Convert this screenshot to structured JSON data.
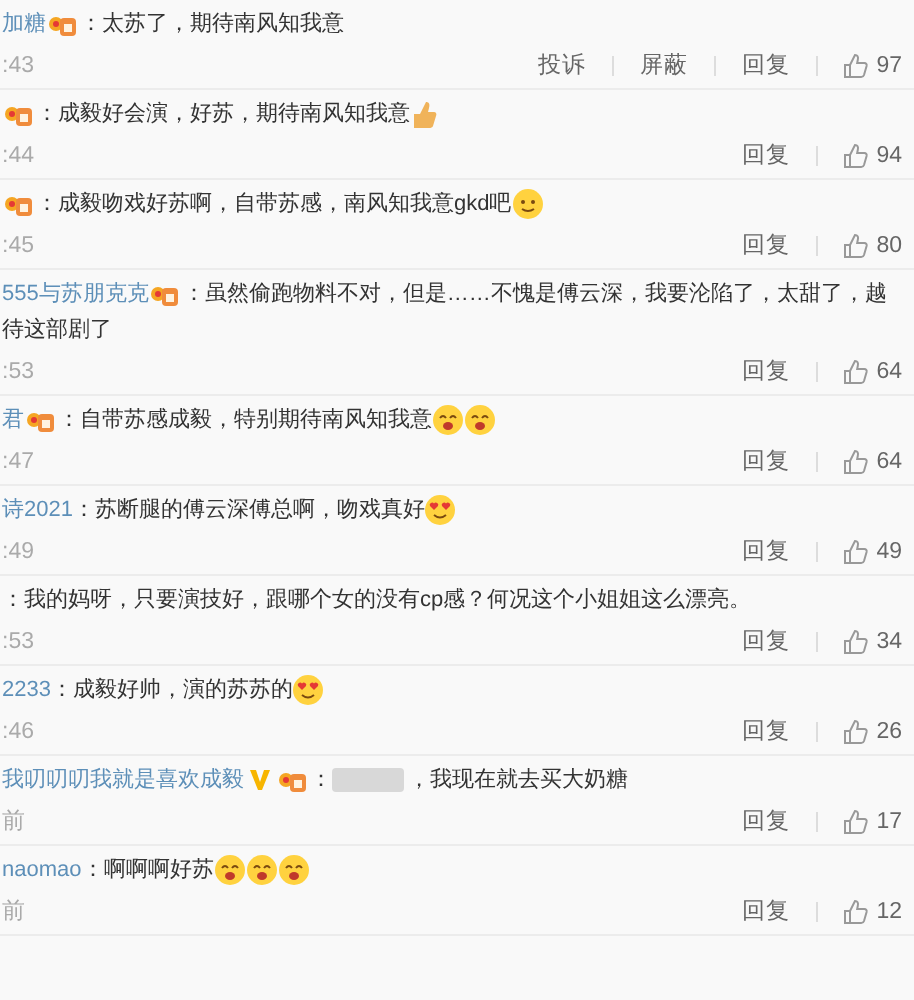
{
  "comments": [
    {
      "user": "加糖",
      "fan_badge": true,
      "lines": [
        "：太苏了，期待南风知我意"
      ],
      "time": ":43",
      "actions": [
        "投诉",
        "屏蔽",
        "回复"
      ],
      "likes": "97"
    },
    {
      "fan_badge": true,
      "lines": [
        "：成毅好会演，好苏，期待南风知我意"
      ],
      "emoji": [
        {
          "kind": "thumbs-up"
        }
      ],
      "time": ":44",
      "actions": [
        "回复"
      ],
      "likes": "94"
    },
    {
      "fan_badge": true,
      "lines": [
        "：成毅吻戏好苏啊，自带苏感，南风知我意gkd吧"
      ],
      "emoji": [
        {
          "kind": "smile"
        }
      ],
      "time": ":45",
      "actions": [
        "回复"
      ],
      "likes": "80"
    },
    {
      "user": "555与苏朋克克",
      "fan_badge": true,
      "lines": [
        "：虽然偷跑物料不对，但是……不愧是傅云深，我要沦陷了，太甜了，越",
        "待这部剧了"
      ],
      "time": ":53",
      "actions": [
        "回复"
      ],
      "likes": "64"
    },
    {
      "user": "君",
      "fan_badge": true,
      "lines": [
        "：自带苏感成毅，特别期待南风知我意"
      ],
      "emoji": [
        {
          "kind": "laugh"
        },
        {
          "kind": "laugh"
        }
      ],
      "time": ":47",
      "actions": [
        "回复"
      ],
      "likes": "64"
    },
    {
      "user": "诗2021",
      "lines": [
        "：苏断腿的傅云深傅总啊，吻戏真好"
      ],
      "emoji": [
        {
          "kind": "heart-eyes"
        }
      ],
      "time": ":49",
      "actions": [
        "回复"
      ],
      "likes": "49"
    },
    {
      "lines": [
        "：我的妈呀，只要演技好，跟哪个女的没有cp感？何况这个小姐姐这么漂亮。"
      ],
      "time": ":53",
      "actions": [
        "回复"
      ],
      "likes": "34"
    },
    {
      "user": "2233",
      "lines": [
        "：成毅好帅，演的苏苏的"
      ],
      "emoji": [
        {
          "kind": "heart-eyes"
        }
      ],
      "time": ":46",
      "actions": [
        "回复"
      ],
      "likes": "26"
    },
    {
      "user": "我叨叨叨我就是喜欢成毅",
      "vip": true,
      "fan_badge": true,
      "lead": "：",
      "redacted": true,
      "lines": [
        "，我现在就去买大奶糖"
      ],
      "time": "前",
      "actions": [
        "回复"
      ],
      "likes": "17"
    },
    {
      "user": "naomao",
      "lines": [
        "：啊啊啊好苏"
      ],
      "emoji": [
        {
          "kind": "laugh"
        },
        {
          "kind": "laugh"
        },
        {
          "kind": "laugh"
        }
      ],
      "time": "前",
      "actions": [
        "回复"
      ],
      "likes": "12"
    }
  ]
}
